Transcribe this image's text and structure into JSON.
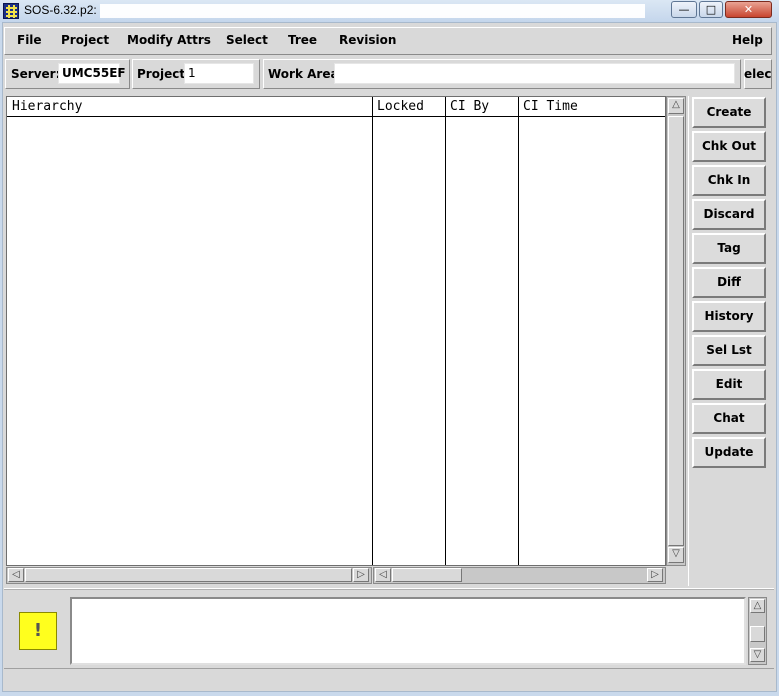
{
  "window": {
    "title": "SOS-6.32.p2:",
    "minimize": "—",
    "maximize": "□",
    "close": "✕"
  },
  "menu": {
    "file": "File",
    "project": "Project",
    "modify_attrs": "Modify Attrs",
    "select": "Select",
    "tree": "Tree",
    "revision": "Revision",
    "help": "Help"
  },
  "server_row": {
    "server_label": "Server:",
    "server_value": "UMC55EF",
    "project_label": "Project:",
    "project_value": "1",
    "workarea_label": "Work Area:",
    "workarea_value": "",
    "select_partial": "elec"
  },
  "table": {
    "columns": [
      "Hierarchy",
      "Locked",
      "CI By",
      "CI Time"
    ],
    "rows": []
  },
  "buttons": [
    "Create",
    "Chk Out",
    "Chk In",
    "Discard",
    "Tag",
    "Diff",
    "History",
    "Sel Lst",
    "Edit",
    "Chat",
    "Update"
  ],
  "message": {
    "icon": "info-exclamation-icon",
    "glyph": "!",
    "text": ""
  },
  "colors": {
    "panel": "#d9d9d9",
    "message_icon": "#ffff1e",
    "title_bar": "#c4d6ec"
  }
}
